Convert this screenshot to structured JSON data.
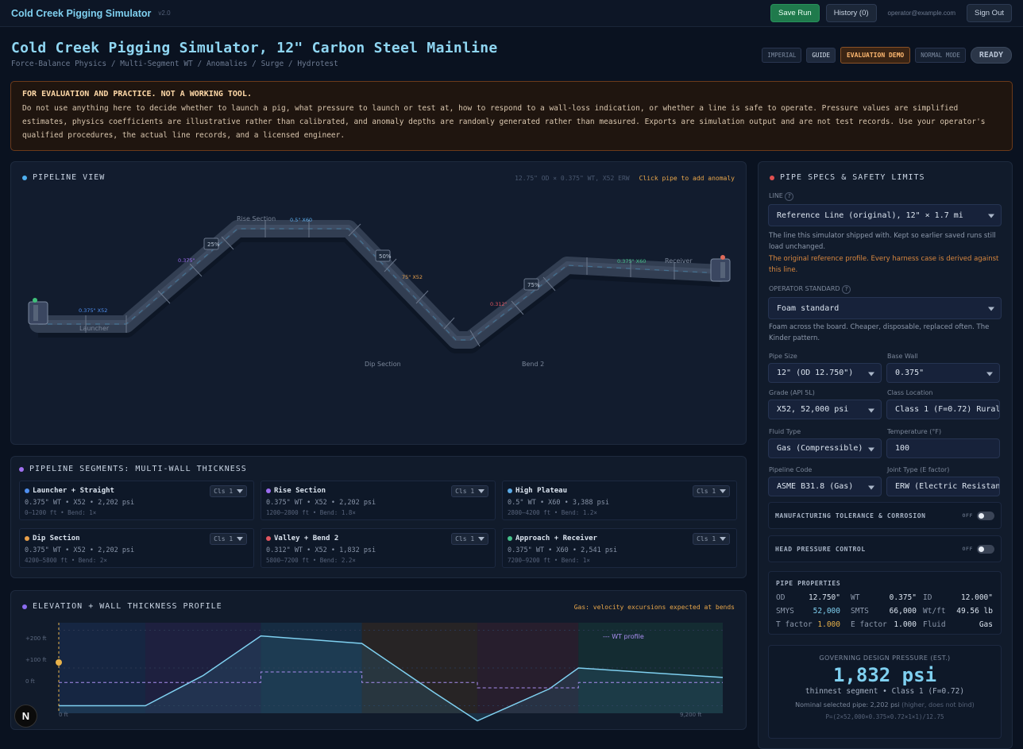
{
  "header": {
    "app_name": "Cold Creek Pigging Simulator",
    "version": "v2.0",
    "save_label": "Save Run",
    "history_label": "History (0)",
    "user_email": "operator@example.com",
    "signout_label": "Sign Out"
  },
  "page": {
    "title": "Cold Creek Pigging Simulator, 12\" Carbon Steel Mainline",
    "subtitle": "Force-Balance Physics / Multi-Segment WT / Anomalies / Surge / Hydrotest",
    "badges": {
      "units": "IMPERIAL",
      "guide": "GUIDE",
      "demo": "EVALUATION DEMO",
      "mode": "NORMAL MODE",
      "status": "READY"
    }
  },
  "warning": {
    "heading": "FOR EVALUATION AND PRACTICE. NOT A WORKING TOOL.",
    "body": "Do not use anything here to decide whether to launch a pig, what pressure to launch or test at, how to respond to a wall-loss indication, or whether a line is safe to operate. Pressure values are simplified estimates, physics coefficients are illustrative rather than calibrated, and anomaly depths are randomly generated rather than measured. Exports are simulation output and are not test records. Use your operator's qualified procedures, the actual line records, and a licensed engineer."
  },
  "pipeline_view": {
    "title": "PIPELINE VIEW",
    "spec": "12.75\" OD × 0.375\" WT, X52 ERW",
    "hint": "Click pipe to add anomaly",
    "labels": {
      "launcher": "Launcher",
      "rise": "Rise Section",
      "dip": "Dip Section",
      "bend2": "Bend 2",
      "receiver": "Receiver"
    },
    "wt_labels": {
      "a": "0.375\" X52",
      "b": "0.375\"",
      "c": "0.5\" X60",
      "d": "75\" X52",
      "e": "0.312\"",
      "f": "0.375\" X60"
    },
    "markers": [
      "25%",
      "50%",
      "75%"
    ]
  },
  "segments": {
    "title": "PIPELINE SEGMENTS: MULTI-WALL THICKNESS",
    "items": [
      {
        "name": "Launcher + Straight",
        "line1": "0.375\" WT • X52 • 2,202 psi",
        "line2": "0–1200 ft • Bend: 1×",
        "cls": "Cls 1",
        "color": "#4f8ff0"
      },
      {
        "name": "Rise Section",
        "line1": "0.375\" WT • X52 • 2,202 psi",
        "line2": "1200–2800 ft • Bend: 1.8×",
        "cls": "Cls 1",
        "color": "#9b6cf0"
      },
      {
        "name": "High Plateau",
        "line1": "0.5\" WT • X60 • 3,388 psi",
        "line2": "2800–4200 ft • Bend: 1.2×",
        "cls": "Cls 1",
        "color": "#5aa9e6"
      },
      {
        "name": "Dip Section",
        "line1": "0.375\" WT • X52 • 2,202 psi",
        "line2": "4200–5800 ft • Bend: 2×",
        "cls": "Cls 1",
        "color": "#e8a04a"
      },
      {
        "name": "Valley + Bend 2",
        "line1": "0.312\" WT • X52 • 1,832 psi",
        "line2": "5800–7200 ft • Bend: 2.2×",
        "cls": "Cls 1",
        "color": "#e0555f"
      },
      {
        "name": "Approach + Receiver",
        "line1": "0.375\" WT • X60 • 2,541 psi",
        "line2": "7200–9200 ft • Bend: 1×",
        "cls": "Cls 1",
        "color": "#45c08a"
      }
    ]
  },
  "profile": {
    "title": "ELEVATION + WALL THICKNESS PROFILE",
    "note": "Gas: velocity excursions expected at bends",
    "legend": "WT profile",
    "y_ticks": [
      "+200 ft",
      "+100 ft",
      "0 ft"
    ],
    "x_start": "0 ft",
    "x_end": "9,200 ft"
  },
  "chart_data": {
    "type": "line",
    "title": "ELEVATION + WALL THICKNESS PROFILE",
    "x_unit": "ft",
    "xlim": [
      0,
      9200
    ],
    "ylim": [
      -20,
      220
    ],
    "y_ticks": [
      0,
      100,
      200
    ],
    "series": [
      {
        "name": "",
        "x": [
          0,
          1200,
          2000,
          2800,
          4200,
          5200,
          5800,
          6800,
          7200,
          9200
        ],
        "y": [
          0,
          0,
          80,
          185,
          165,
          35,
          -40,
          45,
          100,
          75
        ],
        "color": "#7fd0f0"
      },
      {
        "name": "WT profile",
        "x": [
          0,
          2800,
          2800,
          4200,
          4200,
          5800,
          5800,
          7200,
          7200,
          9200
        ],
        "y": [
          0.375,
          0.375,
          0.5,
          0.5,
          0.375,
          0.375,
          0.312,
          0.312,
          0.375,
          0.375
        ],
        "color": "#a98ef0"
      }
    ]
  },
  "specs": {
    "title": "PIPE SPECS & SAFETY LIMITS",
    "line_label": "LINE",
    "line_value": "Reference Line (original), 12\" × 1.7 mi",
    "line_desc": "The line this simulator shipped with. Kept so earlier saved runs still load unchanged.",
    "line_note": "The original reference profile. Every harness case is derived against this line.",
    "standard_label": "OPERATOR STANDARD",
    "standard_value": "Foam standard",
    "standard_desc": "Foam across the board. Cheaper, disposable, replaced often. The Kinder pattern.",
    "fields": [
      {
        "label": "Pipe Size",
        "value": "12\" (OD 12.750\")"
      },
      {
        "label": "Base Wall",
        "value": "0.375\""
      },
      {
        "label": "Grade (API 5L)",
        "value": "X52, 52,000 psi"
      },
      {
        "label": "Class Location",
        "value": "Class 1 (F=0.72) Rural"
      },
      {
        "label": "Fluid Type",
        "value": "Gas (Compressible)"
      },
      {
        "label": "Temperature (°F)",
        "value": "100"
      },
      {
        "label": "Pipeline Code",
        "value": "ASME B31.8 (Gas)"
      },
      {
        "label": "Joint Type (E factor)",
        "value": "ERW (Electric Resistance)"
      }
    ],
    "toggles": [
      {
        "label": "MANUFACTURING TOLERANCE & CORROSION",
        "state": "OFF"
      },
      {
        "label": "HEAD PRESSURE CONTROL",
        "state": "OFF"
      }
    ],
    "props_title": "PIPE PROPERTIES",
    "props": [
      {
        "k": "OD",
        "v": "12.750\""
      },
      {
        "k": "WT",
        "v": "0.375\""
      },
      {
        "k": "ID",
        "v": "12.000\""
      },
      {
        "k": "SMYS",
        "v": "52,000"
      },
      {
        "k": "SMTS",
        "v": "66,000"
      },
      {
        "k": "Wt/ft",
        "v": "49.56 lb"
      },
      {
        "k": "T factor",
        "v": "1.000"
      },
      {
        "k": "E factor",
        "v": "1.000"
      },
      {
        "k": "Fluid",
        "v": "Gas"
      }
    ],
    "gov_title": "GOVERNING DESIGN PRESSURE (EST.)",
    "gov_value": "1,832 psi",
    "gov_sub": "thinnest segment • Class 1 (F=0.72)",
    "gov_nominal": "Nominal selected pipe: 2,202 psi",
    "gov_nominal_note": "(higher, does not bind)",
    "gov_formula": "P=(2×52,000×0.375×0.72×1×1)/12.75"
  },
  "logo": "N"
}
